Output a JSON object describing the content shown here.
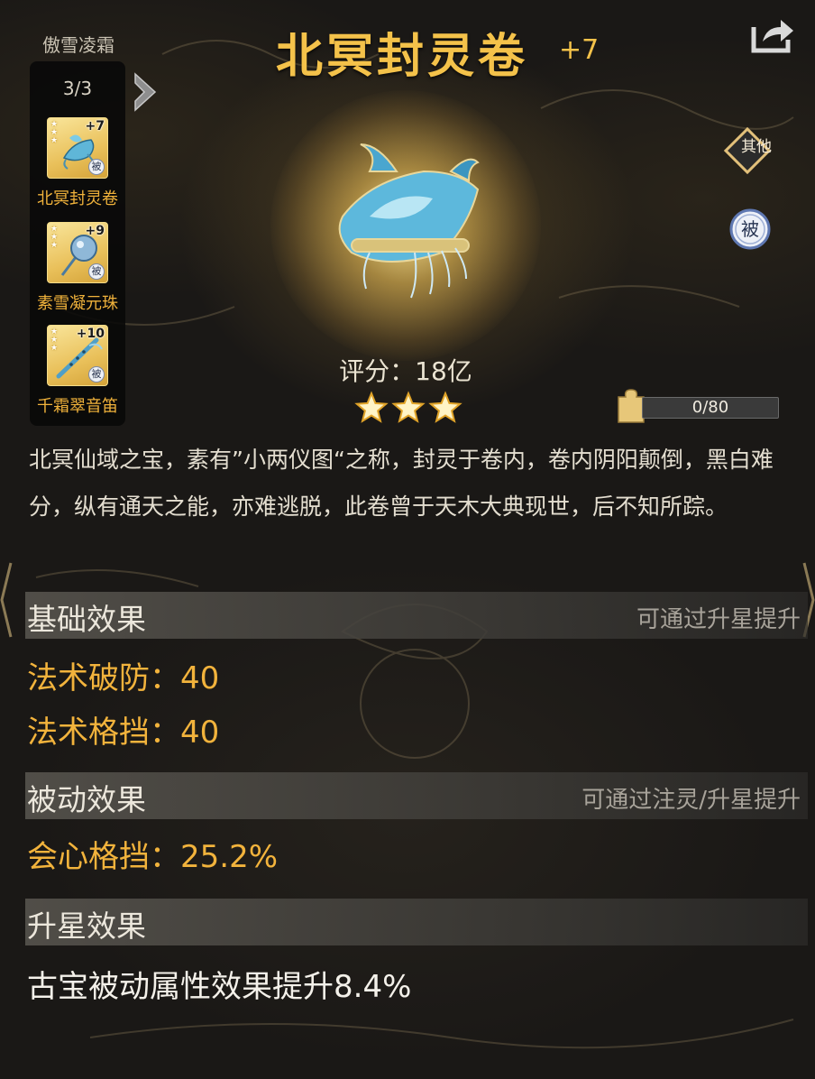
{
  "owner": {
    "name": "傲雪凌霜"
  },
  "slots": {
    "count": "3/3",
    "items": [
      {
        "name": "北冥封灵卷",
        "level": "+7",
        "badge": "被"
      },
      {
        "name": "素雪凝元珠",
        "level": "+9",
        "badge": "被"
      },
      {
        "name": "千霜翠音笛",
        "level": "+10",
        "badge": "被"
      }
    ]
  },
  "item": {
    "title": "北冥封灵卷",
    "level": "+7",
    "score": "评分：18亿",
    "stars": 3,
    "description": "北冥仙域之宝，素有”小两仪图“之称，封灵于卷内，卷内阴阳颠倒，黑白难分，纵有通天之能，亦难逃脱，此卷曾于天木大典现世，后不知所踪。"
  },
  "side_tags": {
    "other": "其他",
    "passive": "被"
  },
  "fragments": {
    "text": "0/80",
    "current": 0,
    "max": 80
  },
  "sections": {
    "basic": {
      "title": "基础效果",
      "hint": "可通过升星提升",
      "stats": [
        "法术破防：40",
        "法术格挡：40"
      ]
    },
    "passive": {
      "title": "被动效果",
      "hint": "可通过注灵/升星提升",
      "stats": [
        "会心格挡：25.2%"
      ]
    },
    "star": {
      "title": "升星效果",
      "text": "古宝被动属性效果提升8.4%"
    }
  },
  "colors": {
    "accent": "#f4c24a",
    "stat": "#f2b33c",
    "slot_name": "#f0b23b"
  },
  "icons": [
    "share-icon",
    "puzzle-icon",
    "star-icon",
    "expand-arrow-icon",
    "scroll-artifact-icon",
    "pearl-artifact-icon",
    "flute-artifact-icon"
  ]
}
